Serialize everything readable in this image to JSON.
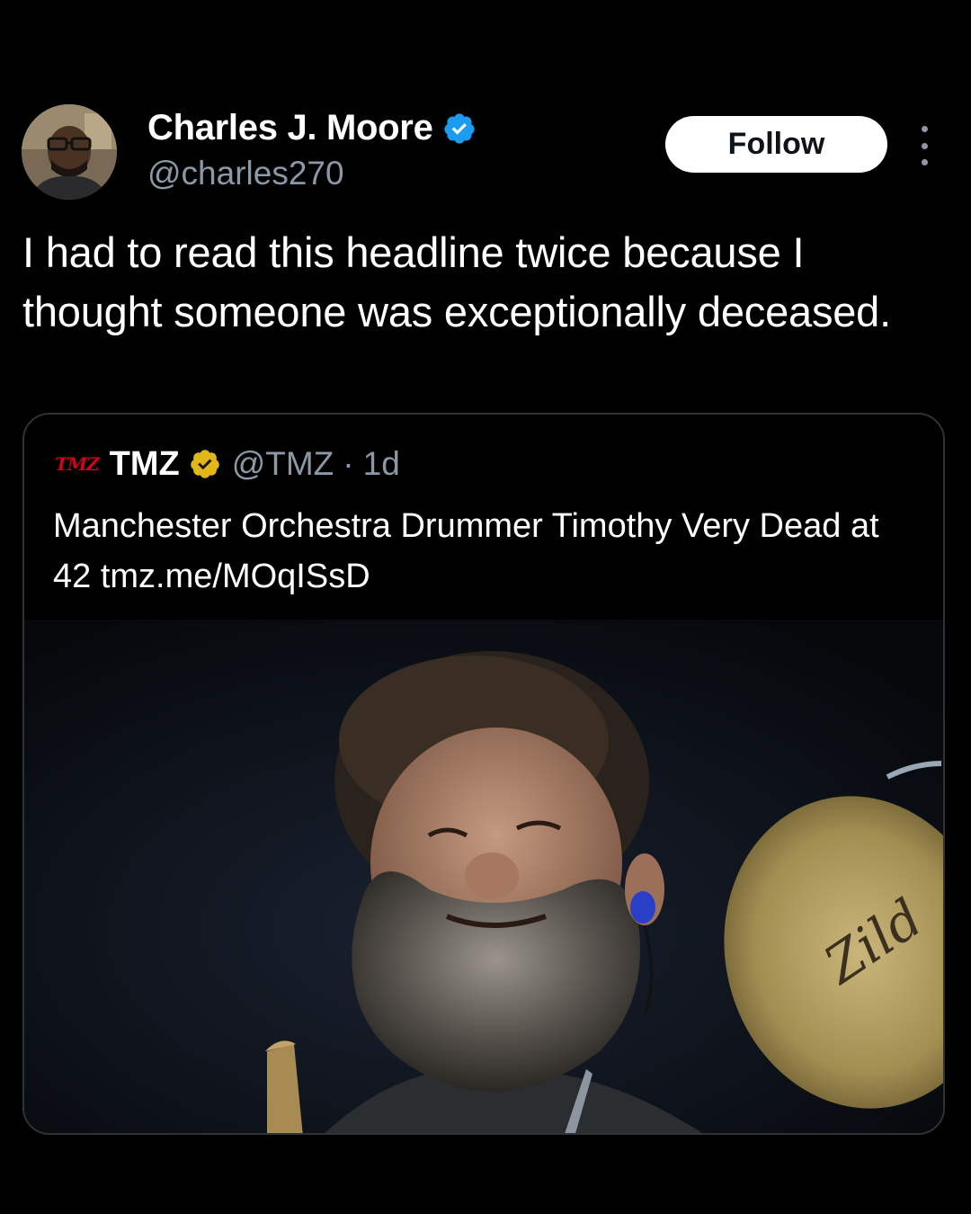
{
  "author": {
    "display_name": "Charles J. Moore",
    "handle": "@charles270",
    "verified_badge": "blue-check-icon"
  },
  "follow_button": {
    "label": "Follow"
  },
  "more_menu": {
    "icon": "more-vertical-icon"
  },
  "tweet": {
    "text": "I had to read this headline twice because I thought someone was exceptionally deceased."
  },
  "quoted_tweet": {
    "logo_text": "TMZ",
    "display_name": "TMZ",
    "verified_badge": "gold-check-icon",
    "handle": "@TMZ",
    "separator": "·",
    "time": "1d",
    "text": "Manchester Orchestra Drummer Timothy Very Dead at 42 tmz.me/MOqISsD",
    "image": {
      "cymbal_brand_text": "Zild"
    }
  },
  "colors": {
    "background": "#000000",
    "text_primary": "#ffffff",
    "text_secondary": "#8b98a5",
    "verified_blue": "#1d9bf0",
    "verified_gold": "#e2b719",
    "tmz_red": "#d0021b",
    "card_border": "#2f3336"
  }
}
